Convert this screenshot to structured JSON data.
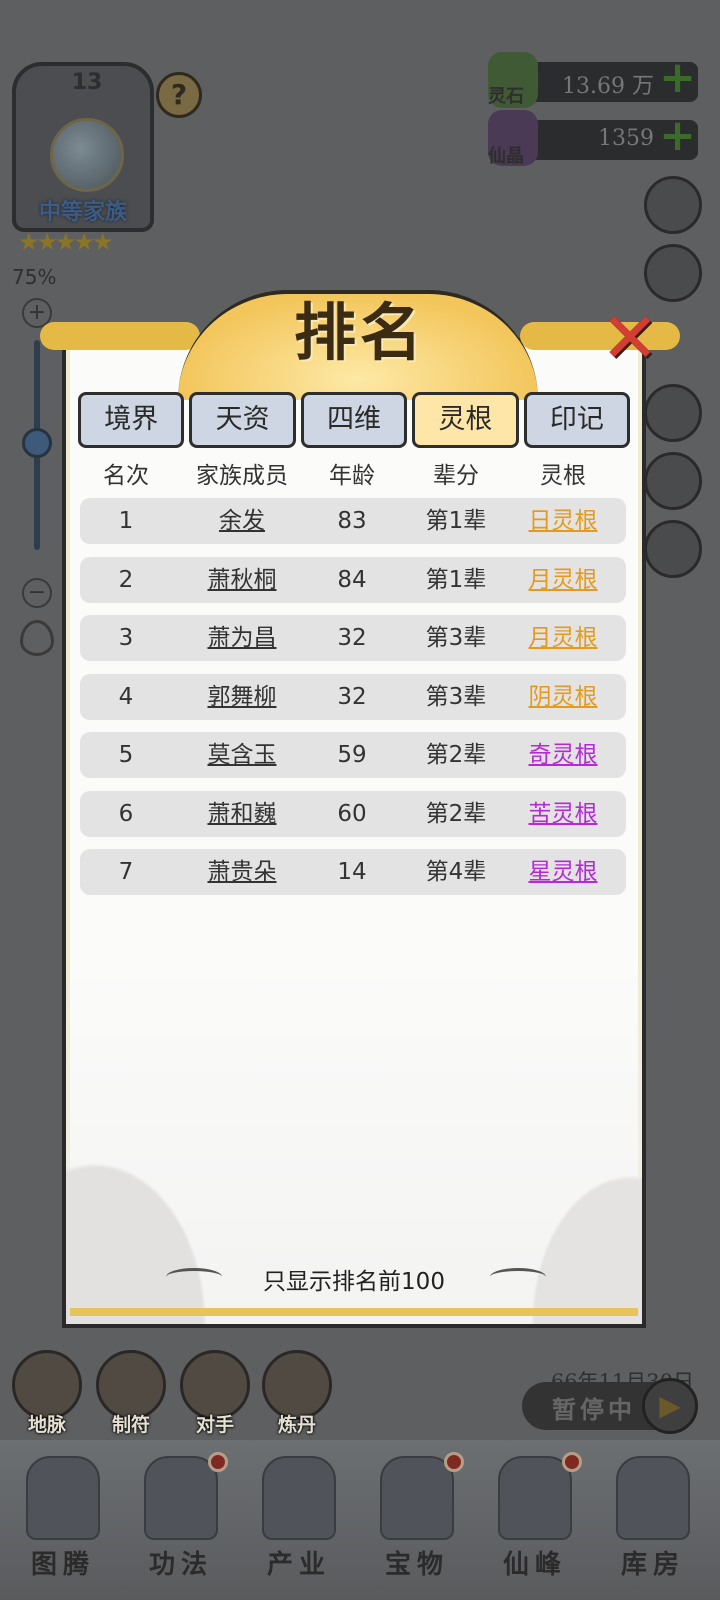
{
  "clan": {
    "level": "13",
    "name": "中等家族",
    "stars": "★★★★★",
    "help": "?"
  },
  "zoom": {
    "percent": "75%",
    "plus": "+",
    "minus": "−"
  },
  "resources": [
    {
      "label": "灵石",
      "value": "13.69 万",
      "plus": "+"
    },
    {
      "label": "仙晶",
      "value": "1359",
      "plus": "+"
    }
  ],
  "dialog": {
    "title": "排名",
    "close": "✕",
    "tabs": [
      {
        "label": "境界",
        "active": false
      },
      {
        "label": "天资",
        "active": false
      },
      {
        "label": "四维",
        "active": false
      },
      {
        "label": "灵根",
        "active": true
      },
      {
        "label": "印记",
        "active": false
      }
    ],
    "columns": [
      "名次",
      "家族成员",
      "年龄",
      "辈分",
      "灵根"
    ],
    "rows": [
      {
        "rank": "1",
        "name": "余发",
        "age": "83",
        "gen": "第1辈",
        "root": "日灵根",
        "color": "#e59a1c"
      },
      {
        "rank": "2",
        "name": "萧秋桐",
        "age": "84",
        "gen": "第1辈",
        "root": "月灵根",
        "color": "#e59a1c"
      },
      {
        "rank": "3",
        "name": "萧为昌",
        "age": "32",
        "gen": "第3辈",
        "root": "月灵根",
        "color": "#e59a1c"
      },
      {
        "rank": "4",
        "name": "郭舞柳",
        "age": "32",
        "gen": "第3辈",
        "root": "阴灵根",
        "color": "#e59a1c"
      },
      {
        "rank": "5",
        "name": "莫含玉",
        "age": "59",
        "gen": "第2辈",
        "root": "奇灵根",
        "color": "#b52ad6"
      },
      {
        "rank": "6",
        "name": "萧和巍",
        "age": "60",
        "gen": "第2辈",
        "root": "苦灵根",
        "color": "#b52ad6"
      },
      {
        "rank": "7",
        "name": "萧贵朵",
        "age": "14",
        "gen": "第4辈",
        "root": "星灵根",
        "color": "#b52ad6"
      }
    ],
    "footer": "只显示排名前100"
  },
  "date": "66年11月30日",
  "pause": {
    "label": "暂停中",
    "icon": "▶"
  },
  "quick_actions": [
    "地脉",
    "制符",
    "对手",
    "炼丹"
  ],
  "bottom_nav": [
    "图腾",
    "功法",
    "产业",
    "宝物",
    "仙峰",
    "库房"
  ]
}
